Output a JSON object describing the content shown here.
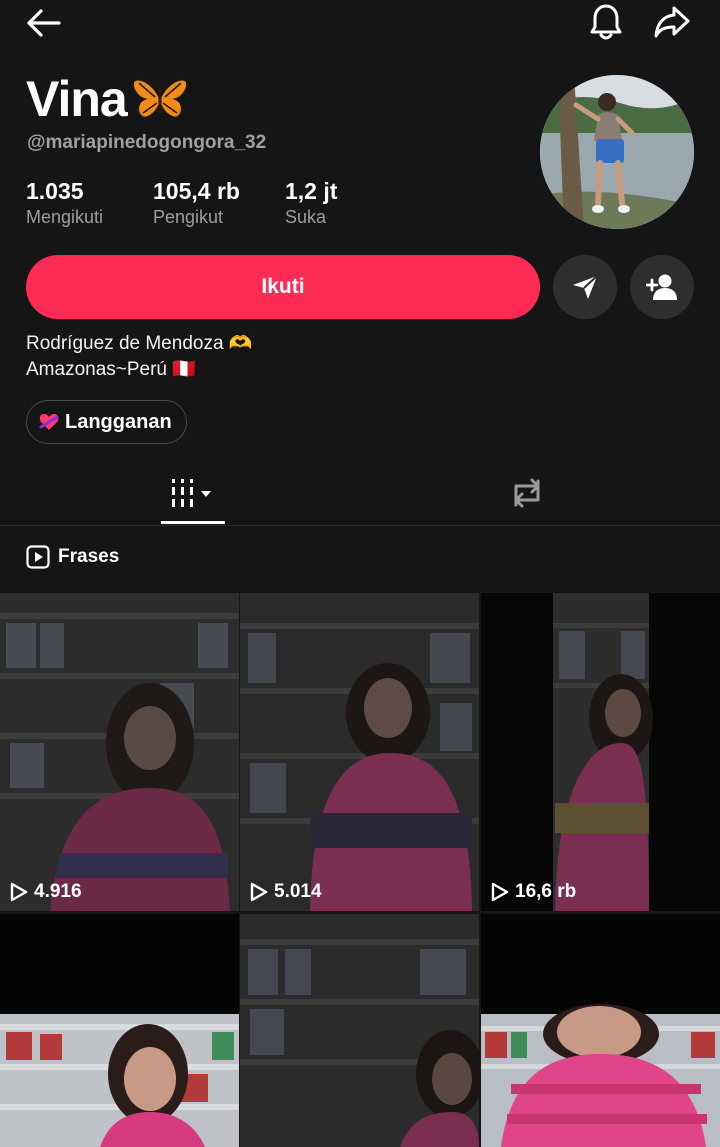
{
  "profile": {
    "name": "Vina",
    "name_emoji": "🦋",
    "handle": "@mariapinedogongora_32"
  },
  "stats": [
    {
      "value": "1.035",
      "label": "Mengikuti"
    },
    {
      "value": "105,4 rb",
      "label": "Pengikut"
    },
    {
      "value": "1,2 jt",
      "label": "Suka"
    }
  ],
  "actions": {
    "follow_label": "Ikuti"
  },
  "bio": {
    "line1": "Rodríguez de Mendoza 🫶",
    "line2": "Amazonas~Perú 🇵🇪"
  },
  "subscription": {
    "label": "Langganan"
  },
  "section": {
    "title": "Frases"
  },
  "videos": [
    {
      "views": "4.916"
    },
    {
      "views": "5.014"
    },
    {
      "views": "16,6 rb"
    },
    {
      "views": ""
    },
    {
      "views": ""
    },
    {
      "views": ""
    }
  ],
  "colors": {
    "accent": "#fe2c55",
    "background": "#151515",
    "secondary_text": "#9d9d9d",
    "button_bg": "#2e2e2e"
  }
}
